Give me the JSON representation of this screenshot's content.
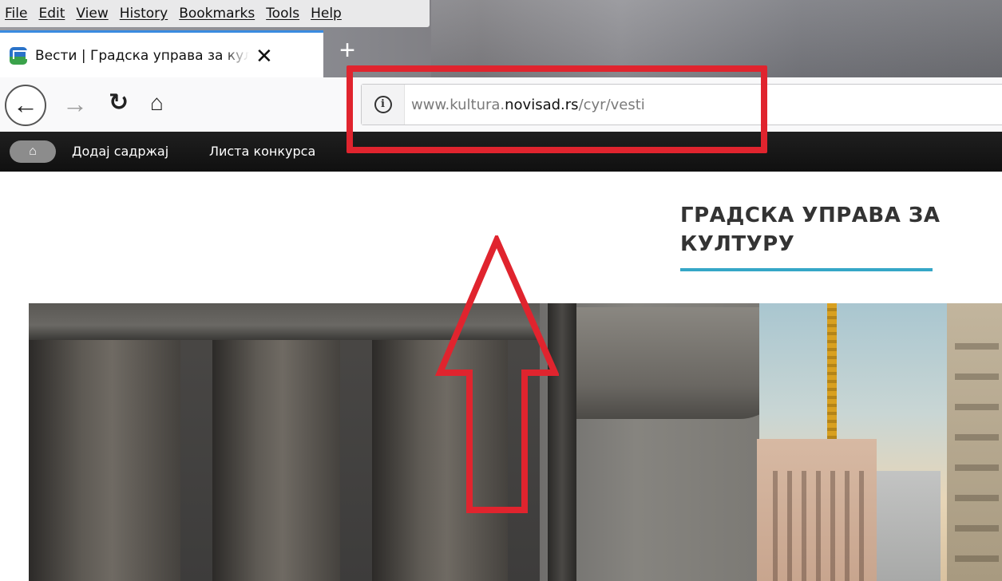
{
  "menubar": {
    "items": [
      "File",
      "Edit",
      "View",
      "History",
      "Bookmarks",
      "Tools",
      "Help"
    ]
  },
  "tab": {
    "title": "Вести | Градска управа за култ",
    "close_icon": "close-icon",
    "favicon": "novi-sad-crest-icon"
  },
  "toolbar": {
    "back_icon": "back-arrow-icon",
    "forward_icon": "forward-arrow-icon",
    "reload_icon": "reload-icon",
    "home_icon": "home-icon",
    "new_tab_icon": "plus-icon"
  },
  "urlbar": {
    "prefix": "www.kultura.",
    "host": "novisad.rs",
    "path": "/cyr/vesti",
    "info_icon": "info-icon"
  },
  "sitebar": {
    "home_icon": "home-icon",
    "links": [
      "Додај садржај",
      "Листа конкурса"
    ]
  },
  "page": {
    "heading_line1": "ГРАДСКА УПРАВА ЗА",
    "heading_line2": "КУЛТУРУ"
  },
  "colors": {
    "annotation_red": "#e0242e",
    "heading_rule": "#35a7c7",
    "tab_accent": "#3a8be0",
    "sitebar_bg": "#141414"
  }
}
